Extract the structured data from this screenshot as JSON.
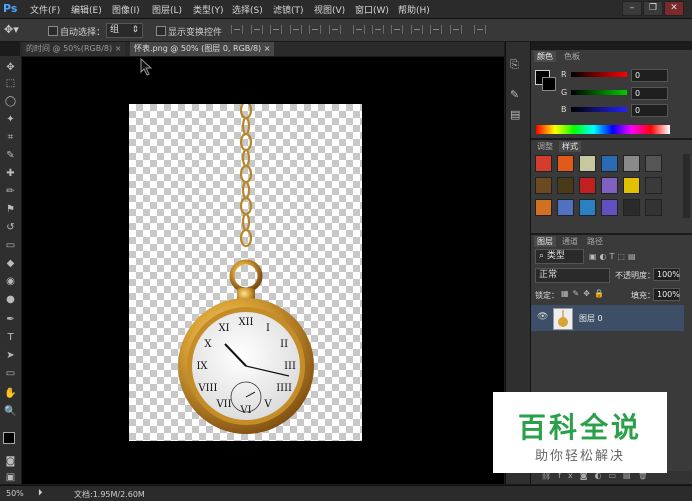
{
  "app": {
    "logo": "Ps"
  },
  "menu": [
    "文件(F)",
    "编辑(E)",
    "图像(I)",
    "图层(L)",
    "类型(Y)",
    "选择(S)",
    "滤镜(T)",
    "视图(V)",
    "窗口(W)",
    "帮助(H)"
  ],
  "window_controls": {
    "minimize": "–",
    "restore": "❐",
    "close": "✕"
  },
  "options_bar": {
    "auto_select_label": "自动选择：",
    "auto_select_value": "组",
    "show_transform_label": "显示变换控件"
  },
  "tabs": [
    {
      "label": "的时间 @ 50%(RGB/8)",
      "close": "×",
      "active": false
    },
    {
      "label": "怀表.png @ 50% (图层 0, RGB/8)",
      "close": "×",
      "active": true
    }
  ],
  "tools": [
    "move-icon",
    "marquee-icon",
    "lasso-icon",
    "quick-select-icon",
    "crop-icon",
    "eyedropper-icon",
    "healing-icon",
    "brush-icon",
    "stamp-icon",
    "history-brush-icon",
    "eraser-icon",
    "paint-bucket-icon",
    "blur-icon",
    "dodge-icon",
    "pen-icon",
    "type-icon",
    "path-select-icon",
    "shape-icon",
    "hand-icon",
    "zoom-icon"
  ],
  "tool_glyphs": [
    "✥",
    "⬚",
    "◯",
    "✦",
    "⌗",
    "✎",
    "✚",
    "✏",
    "⚑",
    "↺",
    "▭",
    "◆",
    "◉",
    "●",
    "✒",
    "T",
    "➤",
    "▭",
    "✋",
    "🔍"
  ],
  "color_panel": {
    "tabs": [
      "颜色",
      "色板"
    ],
    "channels": [
      {
        "label": "R",
        "value": "0",
        "color": "#e03030"
      },
      {
        "label": "G",
        "value": "0",
        "color": "#20b020"
      },
      {
        "label": "B",
        "value": "0",
        "color": "#3040e0"
      }
    ]
  },
  "styles_panel": {
    "tabs": [
      "调整",
      "样式"
    ],
    "swatch_colors": [
      "#d43c2c",
      "#e05a1a",
      "#c8c8a0",
      "#2a6ab0",
      "#8a8a8a",
      "#555555",
      "#6a4a20",
      "#4a3a18",
      "#c02020",
      "#8060c0",
      "#e0c000",
      "#3a3a3a",
      "#d07020",
      "#5070c0",
      "#2a80c0",
      "#6050c0",
      "#2a2a2a",
      "#333333"
    ]
  },
  "layers_panel": {
    "tabs": [
      "图层",
      "通道",
      "路径"
    ],
    "filter_label": "类型",
    "blend_mode": "正常",
    "opacity_label": "不透明度：",
    "opacity_value": "100%",
    "lock_label": "锁定：",
    "fill_label": "填充：",
    "fill_value": "100%",
    "layers": [
      {
        "name": "图层 0"
      }
    ]
  },
  "status": {
    "zoom": "50%",
    "doc": "文档:1.95M/2.60M"
  },
  "watermark": {
    "title": "百科全说",
    "subtitle": "助你轻松解决"
  },
  "colors": {
    "accent": "#4ea6ff",
    "watermark_title": "#2aa04a",
    "selected_layer": "#3d4f66"
  }
}
